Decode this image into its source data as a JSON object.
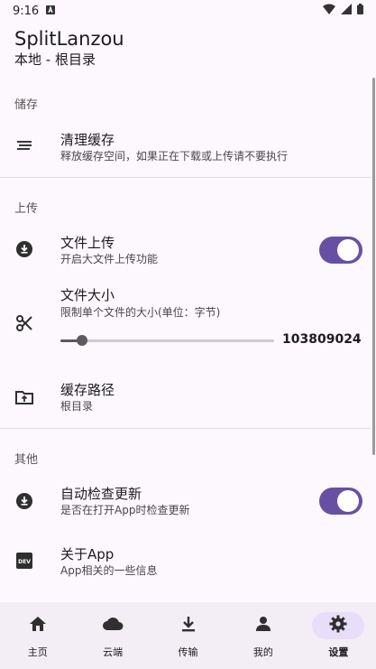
{
  "status_bar": {
    "time": "9:16"
  },
  "header": {
    "title": "SplitLanzou",
    "subtitle": "本地 - 根目录"
  },
  "sections": {
    "storage": "储存",
    "upload": "上传",
    "other": "其他"
  },
  "items": {
    "clear_cache": {
      "title": "清理缓存",
      "summary": "释放缓存空间，如果正在下载或上传请不要执行",
      "icon": "sort-lines-icon"
    },
    "file_upload": {
      "title": "文件上传",
      "summary": "开启大文件上传功能",
      "icon": "download-circle-icon",
      "enabled": true
    },
    "file_size": {
      "title": "文件大小",
      "summary": "限制单个文件的大小(单位：字节)",
      "icon": "scissors-icon",
      "value": "103809024",
      "slider_fraction": 0.1
    },
    "cache_path": {
      "title": "缓存路径",
      "summary": "根目录",
      "icon": "folder-upload-icon"
    },
    "auto_update": {
      "title": "自动检查更新",
      "summary": "是否在打开App时检查更新",
      "icon": "download-circle-icon",
      "enabled": true
    },
    "about": {
      "title": "关于App",
      "summary": "App相关的一些信息",
      "icon": "dev-badge-icon"
    }
  },
  "nav": [
    {
      "label": "主页",
      "icon": "home-icon",
      "active": false
    },
    {
      "label": "云端",
      "icon": "cloud-icon",
      "active": false
    },
    {
      "label": "传输",
      "icon": "download-icon",
      "active": false
    },
    {
      "label": "我的",
      "icon": "person-icon",
      "active": false
    },
    {
      "label": "设置",
      "icon": "gear-icon",
      "active": true
    }
  ],
  "colors": {
    "accent": "#6750a4",
    "background": "#fdf8fd",
    "nav_bg": "#f3edf6",
    "nav_active": "#e8def8"
  }
}
